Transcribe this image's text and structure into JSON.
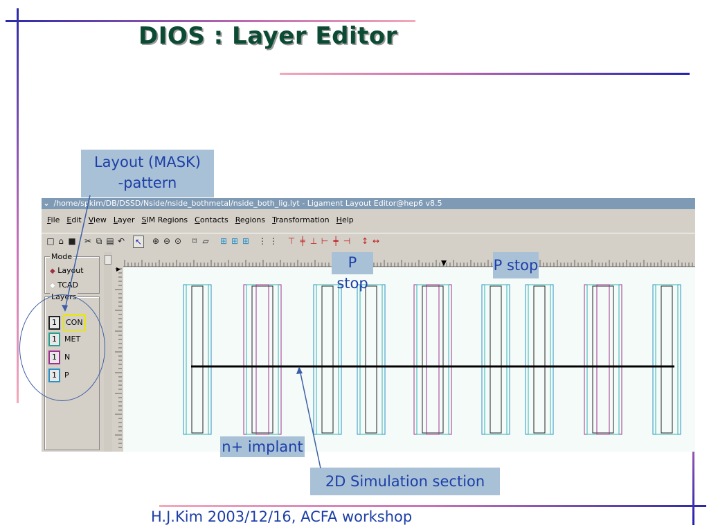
{
  "slide": {
    "title": "DIOS : Layer Editor",
    "footer": "H.J.Kim 2003/12/16,  ACFA workshop",
    "colors": {
      "accent_blue": "#1a1aa8",
      "accent_pink": "#f0a0b4",
      "title_green": "#0b4a33",
      "callout_bg": "#a9c1d6",
      "callout_text": "#1c3ea8"
    }
  },
  "callouts": {
    "layout_mask": "Layout (MASK)\n-pattern",
    "p_stop_1": "P stop",
    "p_stop_2": "P stop",
    "n_implant": "n+ implant",
    "sim_section": "2D Simulation section"
  },
  "app": {
    "window_title": "/home/spkim/DB/DSSD/Nside/nside_bothmetal/nside_both_lig.lyt - Ligament Layout Editor@hep6 v8.5",
    "sysmenu_icon": "chevron-down-icon",
    "menu": [
      {
        "label": "File",
        "mn": "F",
        "rest": "ile"
      },
      {
        "label": "Edit",
        "mn": "E",
        "rest": "dit"
      },
      {
        "label": "View",
        "mn": "V",
        "rest": "iew"
      },
      {
        "label": "Layer",
        "mn": "L",
        "rest": "ayer"
      },
      {
        "label": "SIM Regions",
        "mn": "S",
        "rest": "IM Regions"
      },
      {
        "label": "Contacts",
        "mn": "C",
        "rest": "ontacts"
      },
      {
        "label": "Regions",
        "mn": "R",
        "rest": "egions"
      },
      {
        "label": "Transformation",
        "mn": "T",
        "rest": "ransformation"
      },
      {
        "label": "Help",
        "mn": "H",
        "rest": "elp"
      }
    ],
    "toolbar": [
      {
        "name": "new-file-icon",
        "glyph": "□"
      },
      {
        "name": "open-folder-icon",
        "glyph": "⌂"
      },
      {
        "name": "save-icon",
        "glyph": "■"
      },
      {
        "name": "cut-icon",
        "glyph": "✂"
      },
      {
        "name": "copy-icon",
        "glyph": "⧉"
      },
      {
        "name": "paste-icon",
        "glyph": "▤"
      },
      {
        "name": "undo-icon",
        "glyph": "↶"
      },
      {
        "name": "select-arrow-icon",
        "glyph": "↖"
      },
      {
        "name": "zoom-in-icon",
        "glyph": "⊕"
      },
      {
        "name": "zoom-out-icon",
        "glyph": "⊖"
      },
      {
        "name": "zoom-fit-icon",
        "glyph": "⊙"
      },
      {
        "name": "rectangle-tool-icon",
        "glyph": "⌑"
      },
      {
        "name": "polygon-tool-icon",
        "glyph": "▱"
      },
      {
        "name": "grid-1-icon",
        "glyph": "⊞"
      },
      {
        "name": "grid-2-icon",
        "glyph": "⊞"
      },
      {
        "name": "grid-3-icon",
        "glyph": "⊞"
      },
      {
        "name": "align-1-icon",
        "glyph": "⋮"
      },
      {
        "name": "align-2-icon",
        "glyph": "⋮"
      },
      {
        "name": "align-top-icon",
        "glyph": "⊤"
      },
      {
        "name": "align-middle-icon",
        "glyph": "╪"
      },
      {
        "name": "align-bottom-icon",
        "glyph": "⊥"
      },
      {
        "name": "align-left-icon",
        "glyph": "⊢"
      },
      {
        "name": "align-center-icon",
        "glyph": "┿"
      },
      {
        "name": "align-right-icon",
        "glyph": "⊣"
      },
      {
        "name": "flip-vertical-icon",
        "glyph": "↕"
      },
      {
        "name": "flip-horizontal-icon",
        "glyph": "↔"
      }
    ],
    "mode": {
      "legend": "Mode",
      "options": [
        {
          "label": "Layout",
          "selected": true
        },
        {
          "label": "TCAD",
          "selected": false
        }
      ]
    },
    "layers": {
      "legend": "Layers",
      "items": [
        {
          "num": "1",
          "name": "CON",
          "color": "#222222",
          "highlight": "#e8e800"
        },
        {
          "num": "1",
          "name": "MET",
          "color": "#2a9d8f",
          "highlight": ""
        },
        {
          "num": "1",
          "name": "N",
          "color": "#a03090",
          "highlight": ""
        },
        {
          "num": "1",
          "name": "P",
          "color": "#2a90c8",
          "highlight": ""
        }
      ]
    },
    "layer_colors": {
      "con": "#222222",
      "met": "#2bb3b3",
      "n": "#a03090",
      "p": "#2a90c8",
      "line": "#000000"
    }
  }
}
